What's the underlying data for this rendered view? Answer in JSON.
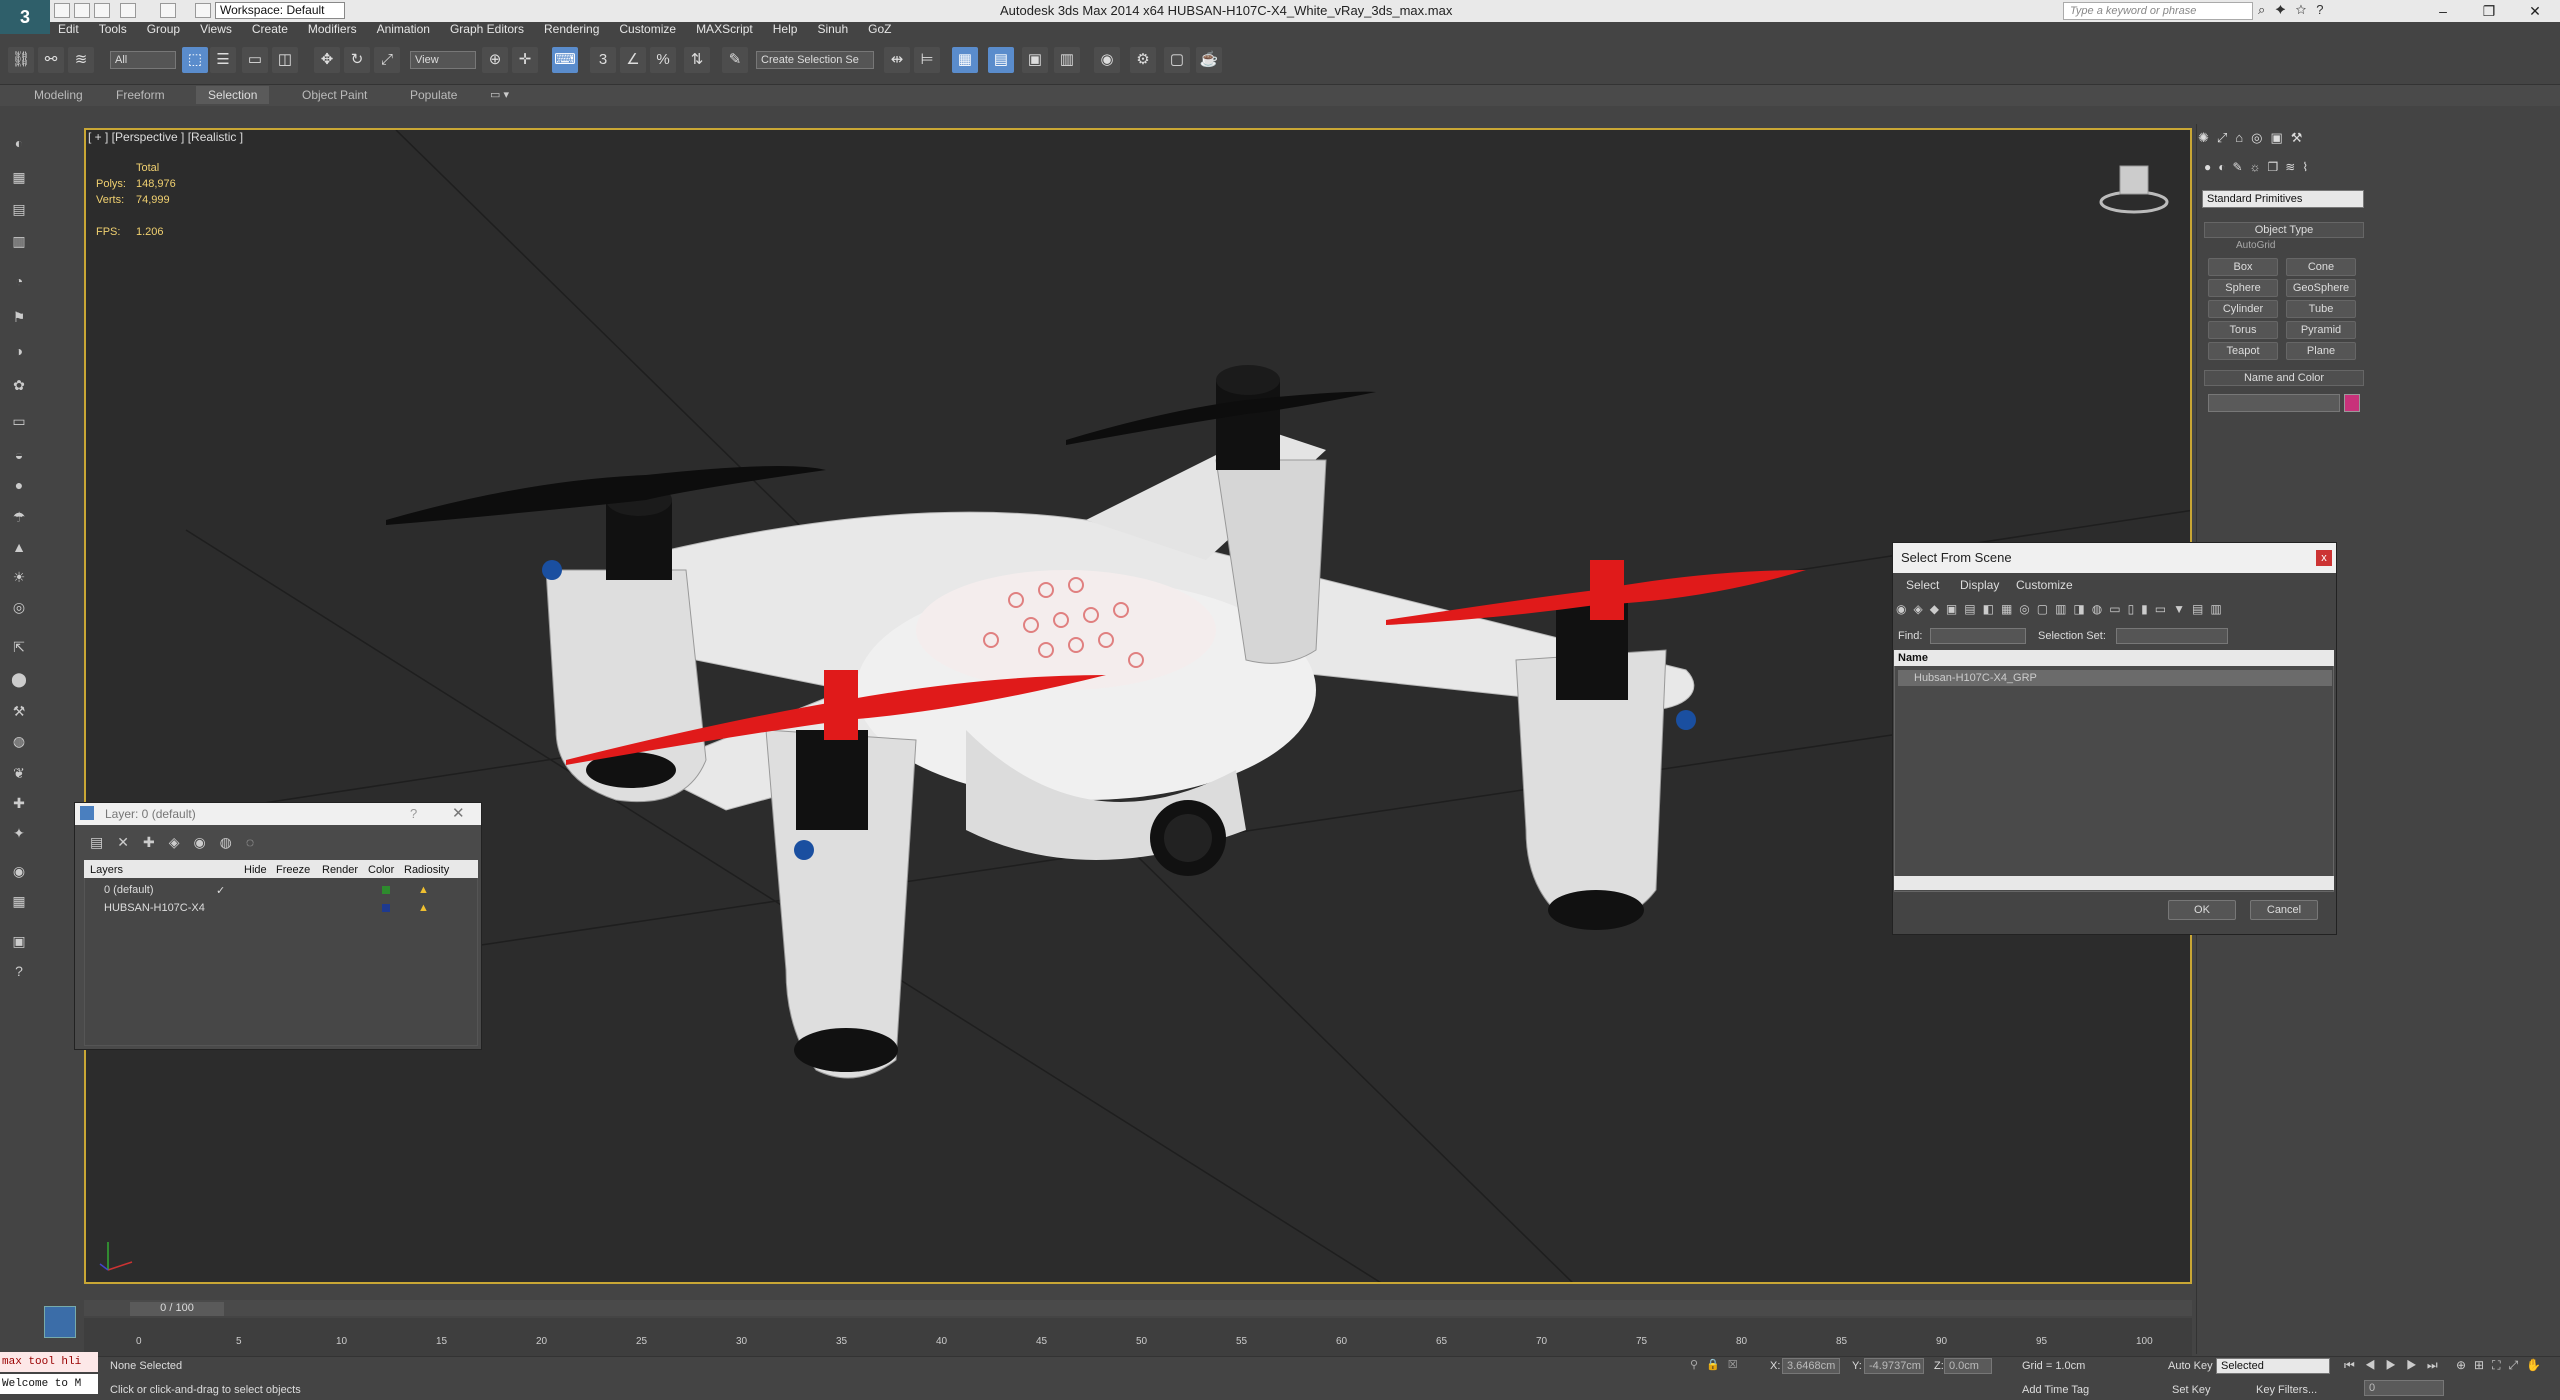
{
  "app": {
    "title": "Autodesk 3ds Max  2014 x64     HUBSAN-H107C-X4_White_vRay_3ds_max.max",
    "workspace": "Workspace: Default",
    "search_placeholder": "Type a keyword or phrase"
  },
  "menu": [
    "Edit",
    "Tools",
    "Group",
    "Views",
    "Create",
    "Modifiers",
    "Animation",
    "Graph Editors",
    "Rendering",
    "Customize",
    "MAXScript",
    "Help",
    "Sinuh",
    "GoZ"
  ],
  "toolbar": {
    "filter": "All",
    "ref_coord": "View",
    "selection_set": "Create Selection Se"
  },
  "ribbon_tabs": [
    {
      "label": "Modeling",
      "active": false
    },
    {
      "label": "Freeform",
      "active": false
    },
    {
      "label": "Selection",
      "active": true
    },
    {
      "label": "Object Paint",
      "active": false
    },
    {
      "label": "Populate",
      "active": false
    }
  ],
  "viewport": {
    "label": "[ + ] [Perspective ] [Realistic ]",
    "stats": {
      "total_label": "Total",
      "polys_label": "Polys:",
      "polys": "148,976",
      "verts_label": "Verts:",
      "verts": "74,999",
      "fps_label": "FPS:",
      "fps": "1.206"
    }
  },
  "command_panel": {
    "category": "Standard Primitives",
    "object_type_title": "Object Type",
    "autogrid": "AutoGrid",
    "buttons": [
      "Box",
      "Cone",
      "Sphere",
      "GeoSphere",
      "Cylinder",
      "Tube",
      "Torus",
      "Pyramid",
      "Teapot",
      "Plane"
    ],
    "name_color_title": "Name and Color",
    "object_color": "#c8327a"
  },
  "layer_dialog": {
    "title": "Layer: 0 (default)",
    "help": "?",
    "columns": [
      "Layers",
      "Hide",
      "Freeze",
      "Render",
      "Color",
      "Radiosity"
    ],
    "rows": [
      {
        "name": "0 (default)",
        "color": "#2e8b2e"
      },
      {
        "name": "HUBSAN-H107C-X4",
        "color": "#1e3a8f"
      }
    ]
  },
  "select_from_scene": {
    "title": "Select From Scene",
    "menu": [
      "Select",
      "Display",
      "Customize"
    ],
    "find_label": "Find:",
    "selection_set_label": "Selection Set:",
    "column_name": "Name",
    "items": [
      "Hubsan-H107C-X4_GRP"
    ],
    "ok": "OK",
    "cancel": "Cancel"
  },
  "timeline": {
    "frame": "0 / 100",
    "ticks": [
      "0",
      "5",
      "10",
      "15",
      "20",
      "25",
      "30",
      "35",
      "40",
      "45",
      "50",
      "55",
      "60",
      "65",
      "70",
      "75",
      "80",
      "85",
      "90",
      "95",
      "100"
    ]
  },
  "status": {
    "maxscript_line1": "max tool hli",
    "maxscript_line2": "Welcome to M",
    "selection": "None Selected",
    "prompt": "Click or click-and-drag to select objects",
    "x_label": "X:",
    "x": "3.6468cm",
    "y_label": "Y:",
    "y": "-4.9737cm",
    "z_label": "Z:",
    "z": "0.0cm",
    "grid": "Grid = 1.0cm",
    "add_time_tag": "Add Time Tag",
    "auto_key": "Auto Key",
    "selected": "Selected",
    "set_key": "Set Key",
    "key_filters": "Key Filters...",
    "current_frame": "0"
  }
}
